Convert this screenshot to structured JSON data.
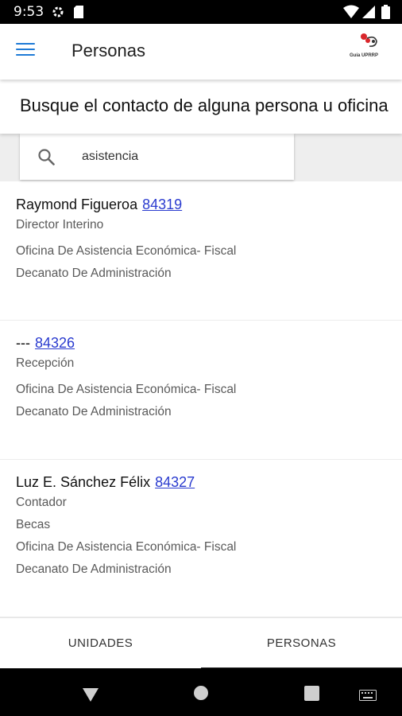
{
  "status_bar": {
    "time": "9:53",
    "icons": [
      "gear-icon",
      "sd-card-icon",
      "wifi-icon",
      "signal-icon",
      "battery-icon"
    ]
  },
  "app_bar": {
    "title": "Personas",
    "logo_text": "Guía UPRRP"
  },
  "banner": {
    "text": "Busque el contacto de alguna persona u oficina"
  },
  "search": {
    "value": "asistencia",
    "icon": "search-icon"
  },
  "results": [
    {
      "name": "Raymond Figueroa",
      "extension": "84319",
      "lines": [
        "Director Interino",
        "Oficina De Asistencia Económica- Fiscal",
        "Decanato De Administración"
      ]
    },
    {
      "name": "---",
      "extension": "84326",
      "lines": [
        "Recepción",
        "Oficina De Asistencia Económica- Fiscal",
        "Decanato De Administración"
      ]
    },
    {
      "name": "Luz E. Sánchez Félix",
      "extension": "84327",
      "lines": [
        "Contador",
        "Becas",
        "Oficina De Asistencia Económica- Fiscal",
        "Decanato De Administración"
      ]
    }
  ],
  "bottom_tabs": [
    {
      "label": "UNIDADES",
      "active": false
    },
    {
      "label": "PERSONAS",
      "active": true
    }
  ],
  "colors": {
    "accent": "#1e7ad6",
    "link": "#2a3bcf",
    "status_bar": "#000000"
  }
}
